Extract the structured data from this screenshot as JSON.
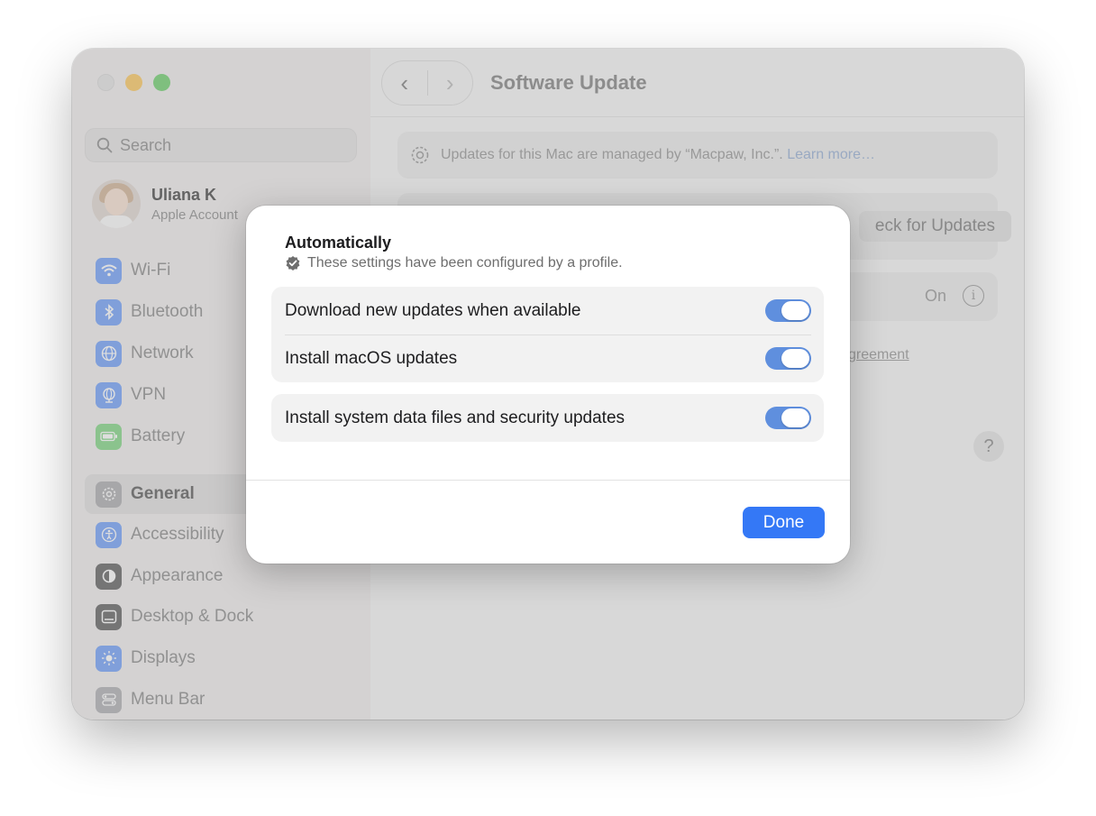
{
  "window": {
    "title": "Software Update"
  },
  "sidebar": {
    "search_placeholder": "Search",
    "user": {
      "name": "Uliana K",
      "subtitle": "Apple Account"
    },
    "items": [
      {
        "label": "Wi-Fi",
        "icon": "wifi-icon",
        "color": "#3478f6"
      },
      {
        "label": "Bluetooth",
        "icon": "bluetooth-icon",
        "color": "#3478f6"
      },
      {
        "label": "Network",
        "icon": "globe-icon",
        "color": "#3478f6"
      },
      {
        "label": "VPN",
        "icon": "vpn-globe-icon",
        "color": "#3478f6"
      },
      {
        "label": "Battery",
        "icon": "battery-icon",
        "color": "#4cc552"
      },
      {
        "label": "General",
        "icon": "gear-icon",
        "color": "#8e8e93"
      },
      {
        "label": "Accessibility",
        "icon": "accessibility-icon",
        "color": "#3478f6"
      },
      {
        "label": "Appearance",
        "icon": "appearance-icon",
        "color": "#1d1d1f"
      },
      {
        "label": "Desktop & Dock",
        "icon": "dock-icon",
        "color": "#1d1d1f"
      },
      {
        "label": "Displays",
        "icon": "sun-icon",
        "color": "#3478f6"
      },
      {
        "label": "Menu Bar",
        "icon": "menubar-icon",
        "color": "#8e8e93"
      }
    ],
    "active_item": "General"
  },
  "content": {
    "managed_text": "Updates for this Mac are managed by “Macpaw, Inc.”.",
    "learn_more": "Learn more…",
    "check_button": "eck for Updates",
    "auto_status": "On",
    "agreement_link": "greement",
    "help": "?"
  },
  "dialog": {
    "title": "Automatically",
    "subtitle": "These settings have been configured by a profile.",
    "group1": [
      {
        "label": "Download new updates when available",
        "on": true
      },
      {
        "label": "Install macOS updates",
        "on": true
      }
    ],
    "group2": [
      {
        "label": "Install system data files and security updates",
        "on": true
      }
    ],
    "done_label": "Done",
    "accent_color": "#3478f6"
  }
}
